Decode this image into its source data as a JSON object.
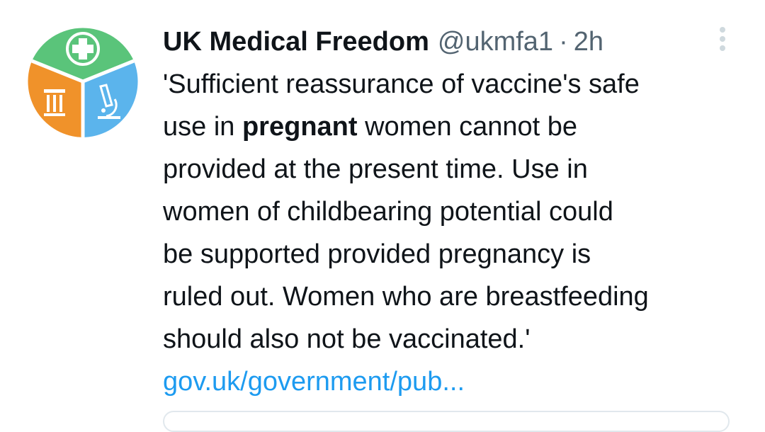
{
  "tweet": {
    "display_name": "UK Medical Freedom",
    "handle": "@ukmfa1",
    "separator": "·",
    "time": "2h",
    "text_lines": [
      "'Sufficient reassurance of vaccine's safe",
      "use in ",
      "pregnant",
      " women cannot be",
      "provided at the present time. Use in",
      "women of childbearing potential could",
      "be supported provided pregnancy is",
      "ruled out. Women who are breastfeeding",
      "should also not be vaccinated.'"
    ],
    "link": "gov.uk/government/pub...",
    "avatar_icon": "medical-freedom-logo",
    "more_icon": "more-vertical-icon"
  },
  "colors": {
    "link": "#1d9bf0",
    "muted": "#536471",
    "text": "#0f1419",
    "logo_green": "#5ac47a",
    "logo_orange": "#f0922a",
    "logo_blue": "#5bb4ec"
  }
}
